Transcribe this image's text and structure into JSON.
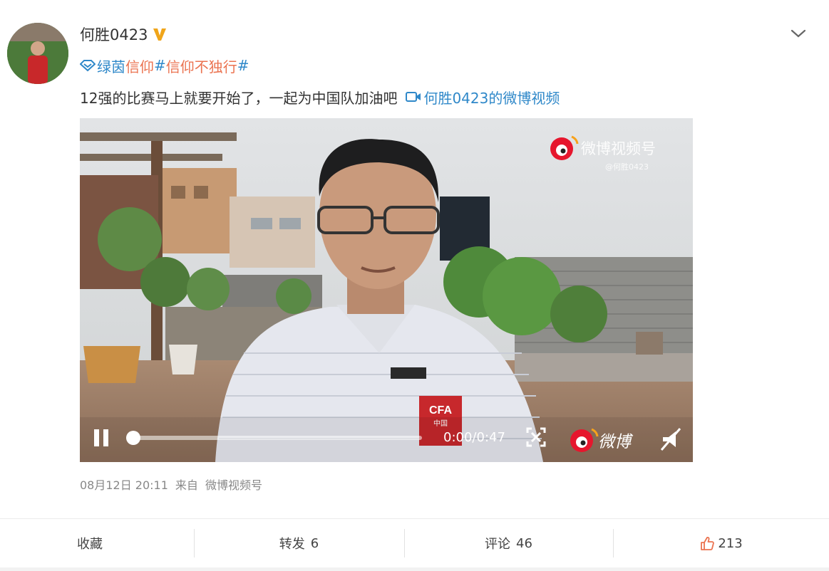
{
  "user": {
    "name": "何胜0423"
  },
  "post": {
    "topic_prefix": "绿茵",
    "topic_link": "信仰",
    "topic_hash1": "#",
    "topic_tag": "信仰不独行",
    "topic_hash2": "#",
    "text": "12强的比赛马上就要开始了，一起为中国队加油吧",
    "video_link_label": "何胜0423的微博视频"
  },
  "video": {
    "watermark_title": "微博视频号",
    "watermark_sub": "@何胜0423",
    "time": "0:00/0:47",
    "brand": "微博",
    "jersey_text": "CFA",
    "jersey_sub": "中国"
  },
  "meta": {
    "date": "08月12日 20:11",
    "from": "来自",
    "source": "微博视频号"
  },
  "actions": {
    "favorite": "收藏",
    "repost": "转发",
    "repost_count": "6",
    "comment": "评论",
    "comment_count": "46",
    "like_count": "213"
  }
}
